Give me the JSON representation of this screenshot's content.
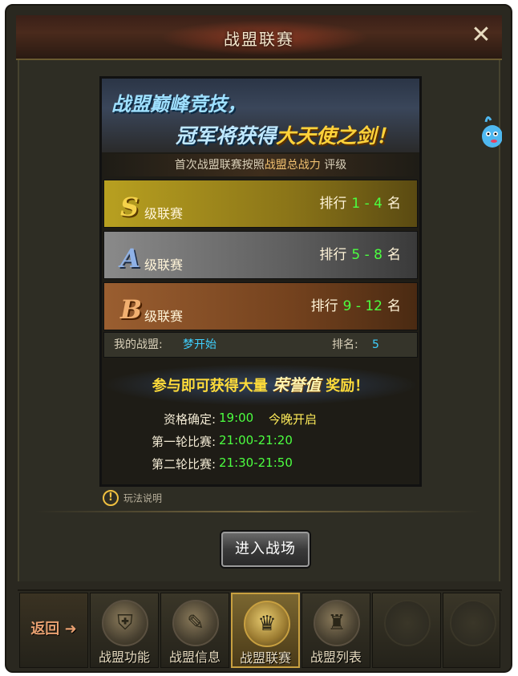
{
  "window": {
    "title": "战盟联赛",
    "close_label": "✕"
  },
  "banner": {
    "line1": "战盟巅峰竞技，",
    "line2_prefix": "冠军将获得",
    "line2_highlight": "大天使之剑！"
  },
  "subinfo": {
    "prefix": "首次战盟联赛按照",
    "highlight": "战盟总战力",
    "suffix": " 评级"
  },
  "tiers": [
    {
      "letter": "S",
      "name": "级联赛",
      "rank_prefix": "排行",
      "range": "1 - 4",
      "rank_suffix": "名"
    },
    {
      "letter": "A",
      "name": "级联赛",
      "rank_prefix": "排行",
      "range": "5 - 8",
      "rank_suffix": "名"
    },
    {
      "letter": "B",
      "name": "级联赛",
      "rank_prefix": "排行",
      "range": "9 - 12",
      "rank_suffix": "名"
    }
  ],
  "my_alliance": {
    "label": "我的战盟:",
    "name": "梦开始",
    "rank_label": "排名:",
    "rank_value": "5"
  },
  "reward": {
    "prefix": "参与即可获得大量",
    "honor": "荣誉值",
    "suffix": "奖励！"
  },
  "schedule": [
    {
      "label": "资格确定:",
      "time": "19:00",
      "note": "今晚开启"
    },
    {
      "label": "第一轮比赛:",
      "time": "21:00-21:20",
      "note": ""
    },
    {
      "label": "第二轮比赛:",
      "time": "21:30-21:50",
      "note": ""
    }
  ],
  "rules": {
    "icon": "!",
    "label": "玩法说明"
  },
  "enter_button": "进入战场",
  "nav": {
    "back_label": "返回",
    "items": [
      {
        "label": "战盟功能",
        "icon": "helmet-icon"
      },
      {
        "label": "战盟信息",
        "icon": "scroll-icon"
      },
      {
        "label": "战盟联赛",
        "icon": "trophy-icon",
        "active": true
      },
      {
        "label": "战盟列表",
        "icon": "castle-icon"
      }
    ]
  },
  "colors": {
    "gold": "#ffd23a",
    "green": "#4cff40",
    "cyan": "#3fd0ff"
  }
}
